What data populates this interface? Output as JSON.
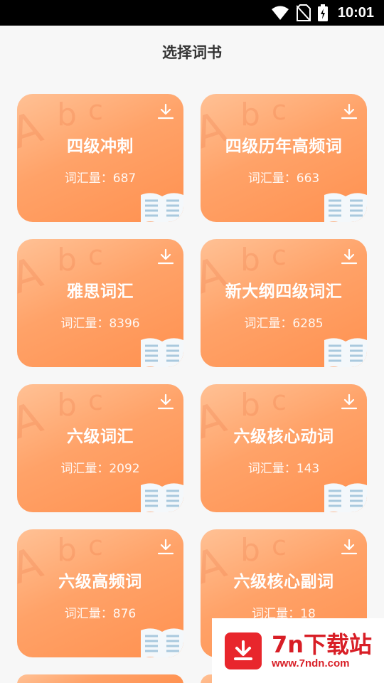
{
  "status_bar": {
    "time": "10:01"
  },
  "page": {
    "title": "选择词书"
  },
  "books": [
    {
      "name": "四级冲刺",
      "count": "词汇量：687"
    },
    {
      "name": "四级历年高频词",
      "count": "词汇量：663"
    },
    {
      "name": "雅思词汇",
      "count": "词汇量：8396"
    },
    {
      "name": "新大纲四级词汇",
      "count": "词汇量：6285"
    },
    {
      "name": "六级词汇",
      "count": "词汇量：2092"
    },
    {
      "name": "六级核心动词",
      "count": "词汇量：143"
    },
    {
      "name": "六级高频词",
      "count": "词汇量：876"
    },
    {
      "name": "六级核心副词",
      "count": "词汇量：18"
    }
  ],
  "watermark": {
    "title": "7n下载站",
    "url": "www.7ndn.com"
  },
  "colors": {
    "card_start": "#ffc195",
    "card_end": "#ff9150",
    "brand_red": "#d81e26"
  }
}
